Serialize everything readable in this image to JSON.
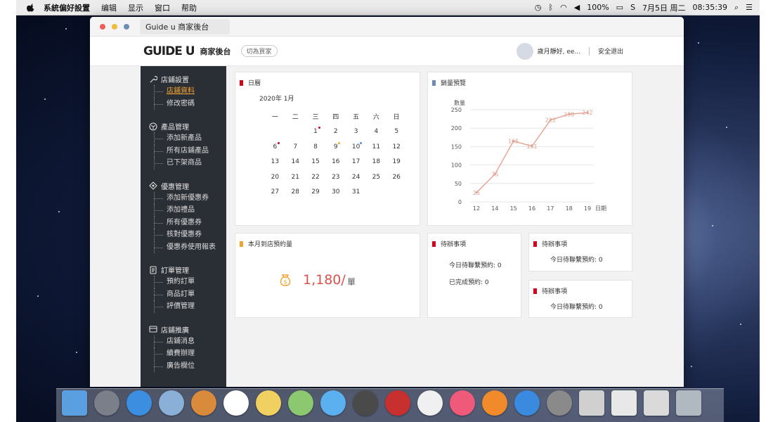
{
  "menubar": {
    "app": "系統偏好設置",
    "items": [
      "编辑",
      "显示",
      "窗口",
      "帮助"
    ],
    "battery": "100%",
    "date": "7月5日 周二",
    "time": "08:35:39"
  },
  "browser": {
    "tab_title": "Guide u 商家後台"
  },
  "header": {
    "logo": "GUIDE U",
    "brand": "商家後台",
    "switch_label": "切為買家",
    "greeting": "歲月靜好, ee...",
    "logout": "安全退出"
  },
  "sidebar": {
    "groups": [
      {
        "title": "店鋪設置",
        "icon": "wrench-icon",
        "items": [
          "店鋪資料",
          "修改密碼"
        ],
        "active": 0
      },
      {
        "title": "產品管理",
        "icon": "box-icon",
        "items": [
          "添加新產品",
          "所有店鋪產品",
          "已下架商品"
        ]
      },
      {
        "title": "優惠管理",
        "icon": "diamond-icon",
        "items": [
          "添加新優惠券",
          "添加禮品",
          "所有優惠券",
          "核對優惠券",
          "優惠券使用報表"
        ]
      },
      {
        "title": "訂單管理",
        "icon": "order-icon",
        "items": [
          "預約訂單",
          "商品訂單",
          "評價管理"
        ]
      },
      {
        "title": "店鋪推廣",
        "icon": "promo-icon",
        "items": [
          "店鋪消息",
          "續費辦理",
          "廣告欄位"
        ]
      }
    ]
  },
  "calendar": {
    "title": "日曆",
    "month_label": "2020年  1月",
    "weekdays": [
      "一",
      "二",
      "三",
      "四",
      "五",
      "六",
      "日"
    ],
    "weeks": [
      [
        "",
        "",
        "1",
        "2",
        "3",
        "4",
        "5"
      ],
      [
        "6",
        "7",
        "8",
        "9",
        "10",
        "11",
        "12"
      ],
      [
        "13",
        "14",
        "15",
        "16",
        "17",
        "18",
        "19"
      ],
      [
        "20",
        "21",
        "22",
        "23",
        "24",
        "25",
        "26"
      ],
      [
        "27",
        "28",
        "29",
        "30",
        "31",
        "",
        ""
      ]
    ],
    "dots": [
      {
        "day": "1",
        "color": "#d0021b"
      },
      {
        "day": "6",
        "color": "#d0021b"
      },
      {
        "day": "9",
        "color": "#f5a623"
      },
      {
        "day": "10",
        "color": "#4a90e2"
      }
    ]
  },
  "sales": {
    "title": "銷量預覽"
  },
  "chart_data": {
    "type": "line",
    "title": "",
    "ylabel": "數量",
    "xlabel": "日期",
    "x": [
      "12",
      "14",
      "15",
      "16",
      "17",
      "18",
      "19"
    ],
    "values": [
      25,
      75,
      165,
      151,
      222,
      238,
      242
    ],
    "ylim": [
      0,
      250
    ],
    "yticks": [
      0,
      50,
      100,
      150,
      200,
      250
    ],
    "grid": true,
    "color": "#e8a090"
  },
  "monthly": {
    "title": "本月到店預約量",
    "value": "1,180/",
    "unit": "單"
  },
  "todo_main": {
    "title": "待辦事項",
    "line1": "今日待聯繫預約: 0",
    "line2": "已完成預約: 0"
  },
  "todo_a": {
    "title": "待辦事項",
    "line1": "今日待聯繫預約: 0"
  },
  "todo_b": {
    "title": "待辦事項",
    "line1": "今日待聯繫預約: 0"
  },
  "colors": {
    "accent_red": "#d0021b",
    "accent_blue": "#6b8db5",
    "accent_orange": "#f0a332",
    "sidebar_bg": "#2a2e35"
  }
}
